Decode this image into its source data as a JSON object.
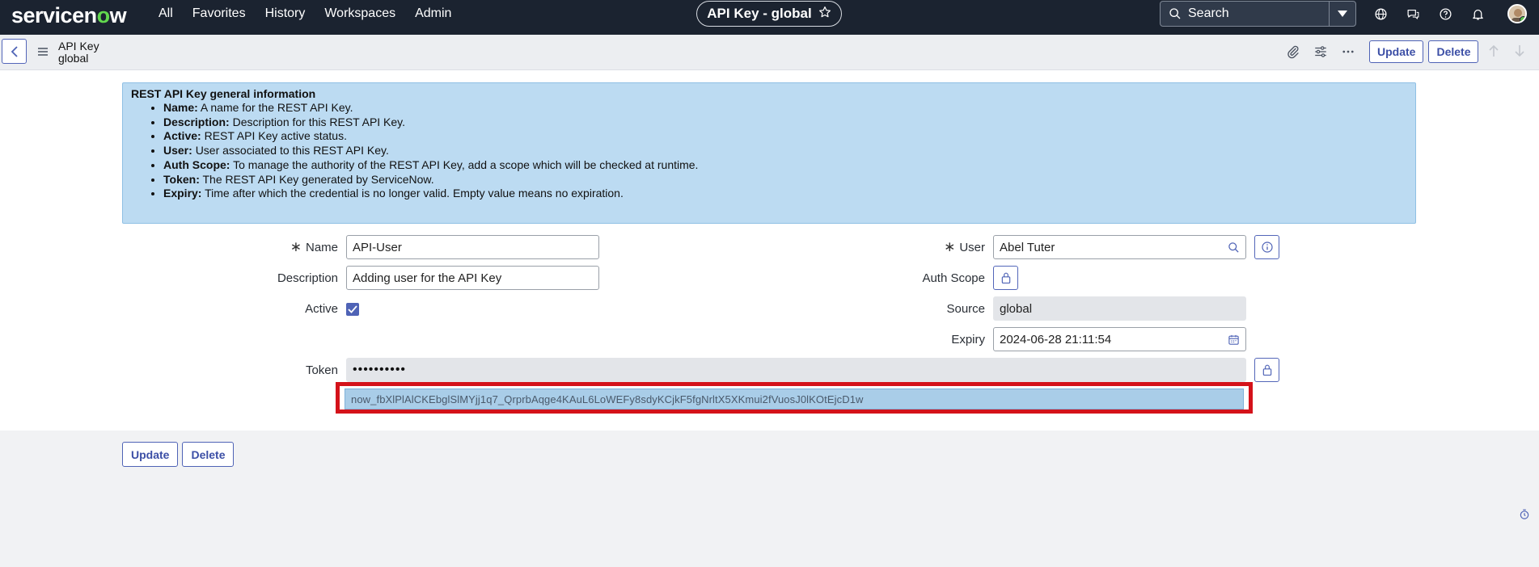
{
  "nav": {
    "logo_text": "servicenow",
    "links": [
      "All",
      "Favorites",
      "History",
      "Workspaces",
      "Admin"
    ],
    "context_pill": "API Key - global",
    "search_label": "Search"
  },
  "header": {
    "record_type": "API Key",
    "record_scope": "global",
    "update_label": "Update",
    "delete_label": "Delete"
  },
  "info": {
    "title": "REST API Key general information",
    "items": [
      {
        "term": "Name:",
        "desc": "A name for the REST API Key."
      },
      {
        "term": "Description:",
        "desc": "Description for this REST API Key."
      },
      {
        "term": "Active:",
        "desc": "REST API Key active status."
      },
      {
        "term": "User:",
        "desc": "User associated to this REST API Key."
      },
      {
        "term": "Auth Scope:",
        "desc": "To manage the authority of the REST API Key, add a scope which will be checked at runtime."
      },
      {
        "term": "Token:",
        "desc": "The REST API Key generated by ServiceNow."
      },
      {
        "term": "Expiry:",
        "desc": "Time after which the credential is no longer valid. Empty value means no expiration."
      }
    ]
  },
  "form": {
    "required_mark": "∗",
    "name_label": "Name",
    "name_value": "API-User",
    "description_label": "Description",
    "description_value": "Adding user for the API Key",
    "active_label": "Active",
    "active_checked": true,
    "user_label": "User",
    "user_value": "Abel Tuter",
    "auth_scope_label": "Auth Scope",
    "source_label": "Source",
    "source_value": "global",
    "expiry_label": "Expiry",
    "expiry_value": "2024-06-28 21:11:54",
    "token_label": "Token",
    "token_masked": "••••••••••",
    "token_revealed": "now_fbXlPlAlCKEbglSlMYjj1q7_QrprbAqge4KAuL6LoWEFy8sdyKCjkF5fgNrltX5XKmui2fVuosJ0lKOtEjcD1w"
  },
  "footer": {
    "update_label": "Update",
    "delete_label": "Delete"
  },
  "colors": {
    "nav_bg": "#1b2330",
    "accent": "#4f63b6",
    "info_bg": "#bcdbf2",
    "highlight": "#d4121a"
  }
}
